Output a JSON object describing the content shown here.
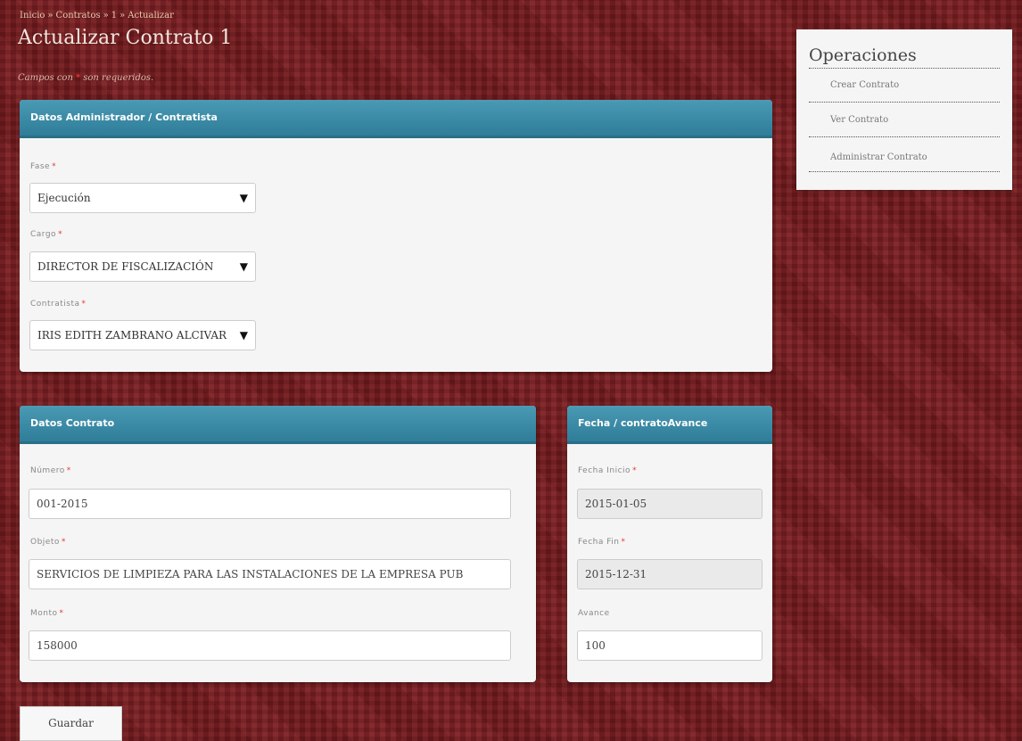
{
  "breadcrumb": [
    "Inicio",
    "Contratos",
    "1",
    "Actualizar"
  ],
  "breadcrumb_sep": "»",
  "page_title": "Actualizar Contrato 1",
  "required_note": {
    "prefix": "Campos con",
    "star": "*",
    "suffix": "son requeridos."
  },
  "panel_admin": {
    "title": "Datos Administrador / Contratista",
    "fase": {
      "label": "Fase",
      "value": "Ejecución"
    },
    "cargo": {
      "label": "Cargo",
      "value": "DIRECTOR DE FISCALIZACIÓN"
    },
    "contratista": {
      "label": "Contratista",
      "value": "IRIS EDITH ZAMBRANO ALCIVAR"
    }
  },
  "panel_contrato": {
    "title": "Datos Contrato",
    "numero": {
      "label": "Número",
      "value": "001-2015"
    },
    "objeto": {
      "label": "Objeto",
      "value": "SERVICIOS DE LIMPIEZA PARA LAS INSTALACIONES DE LA EMPRESA PUB"
    },
    "monto": {
      "label": "Monto",
      "value": "158000"
    }
  },
  "panel_fecha": {
    "title": "Fecha / contratoAvance",
    "fecha_inicio": {
      "label": "Fecha Inicio",
      "value": "2015-01-05"
    },
    "fecha_fin": {
      "label": "Fecha Fin",
      "value": "2015-12-31"
    },
    "avance": {
      "label": "Avance",
      "value": "100"
    }
  },
  "required_star": "*",
  "select_arrow": "▼",
  "operations": {
    "title": "Operaciones",
    "items": [
      "Crear Contrato",
      "Ver Contrato",
      "Administrar Contrato"
    ]
  },
  "save_label": "Guardar"
}
